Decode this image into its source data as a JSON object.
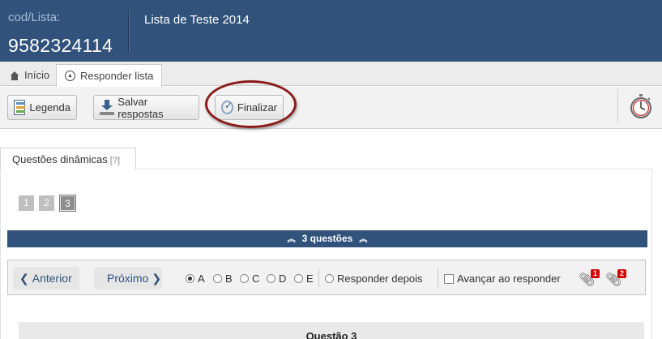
{
  "header": {
    "cod_label": "cod/Lista:",
    "cod_value": "9582324114",
    "list_title": "Lista de Teste 2014"
  },
  "tabs": [
    {
      "label": "Início",
      "icon": "home-icon",
      "active": false
    },
    {
      "label": "Responder lista",
      "icon": "circle-up-icon",
      "active": true
    }
  ],
  "toolbar": {
    "legenda_label": "Legenda",
    "salvar_label": "Salvar respostas",
    "finalizar_label": "Finalizar",
    "timer_icon": "stopwatch-icon"
  },
  "subtab": {
    "label": "Questões dinâmicas",
    "help": "[?]"
  },
  "pagination": {
    "pages": [
      "1",
      "2",
      "3"
    ],
    "current": "3"
  },
  "section_bar": {
    "label": "3 questões"
  },
  "nav": {
    "anterior_label": "Anterior",
    "proximo_label": "Próximo",
    "options": [
      "A",
      "B",
      "C",
      "D",
      "E"
    ],
    "selected_option": "A",
    "responder_depois_label": "Responder depois",
    "avancar_label": "Avançar ao responder",
    "attachment_badges": [
      "1",
      "2"
    ]
  },
  "question": {
    "title": "Questão 3"
  },
  "colors": {
    "header_bg": "#30527b",
    "highlight_ring": "#8c1c1c",
    "badge_red": "#d60000"
  }
}
